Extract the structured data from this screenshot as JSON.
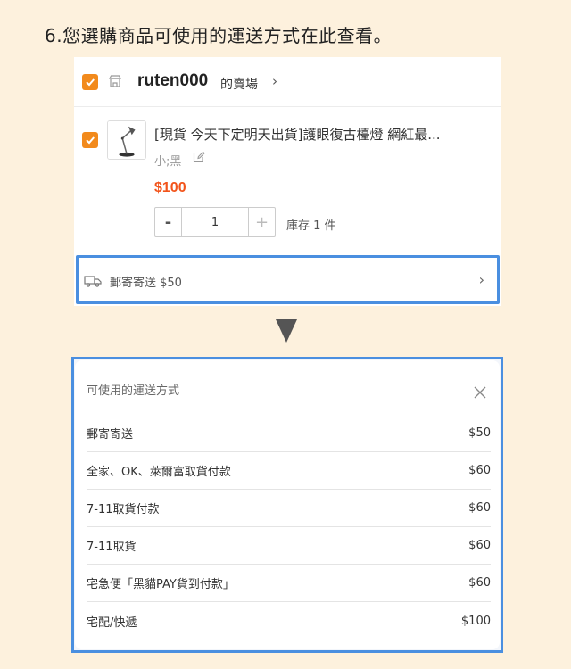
{
  "step_title": "6.您選購商品可使用的運送方式在此查看。",
  "shop": {
    "name": "ruten000",
    "suffix": "的賣場",
    "chevron": "›"
  },
  "product": {
    "title": "[現貨 今天下定明天出貨]護眼復古檯燈 網紅最...",
    "variant": "小;黑",
    "price": "$100",
    "quantity": "1",
    "qty_minus": "-",
    "qty_plus": "+",
    "stock": "庫存 1 件"
  },
  "shipping": {
    "selected": "郵寄寄送 $50",
    "chevron": "›"
  },
  "modal": {
    "title": "可使用的運送方式",
    "options": [
      {
        "name": "郵寄寄送",
        "price": "$50"
      },
      {
        "name": "全家、OK、萊爾富取貨付款",
        "price": "$60"
      },
      {
        "name": "7-11取貨付款",
        "price": "$60"
      },
      {
        "name": "7-11取貨",
        "price": "$60"
      },
      {
        "name": "宅急便「黑貓PAY貨到付款」",
        "price": "$60"
      },
      {
        "name": "宅配/快遞",
        "price": "$100"
      }
    ]
  },
  "colors": {
    "background": "#fdf1dd",
    "checkbox": "#f28a1c",
    "price": "#f2541b",
    "highlight": "#4a8fe0"
  },
  "icons": {
    "shop": "store-icon",
    "edit": "edit-icon",
    "shipping": "truck-icon",
    "close": "close-icon",
    "arrow": "down-triangle-icon"
  }
}
